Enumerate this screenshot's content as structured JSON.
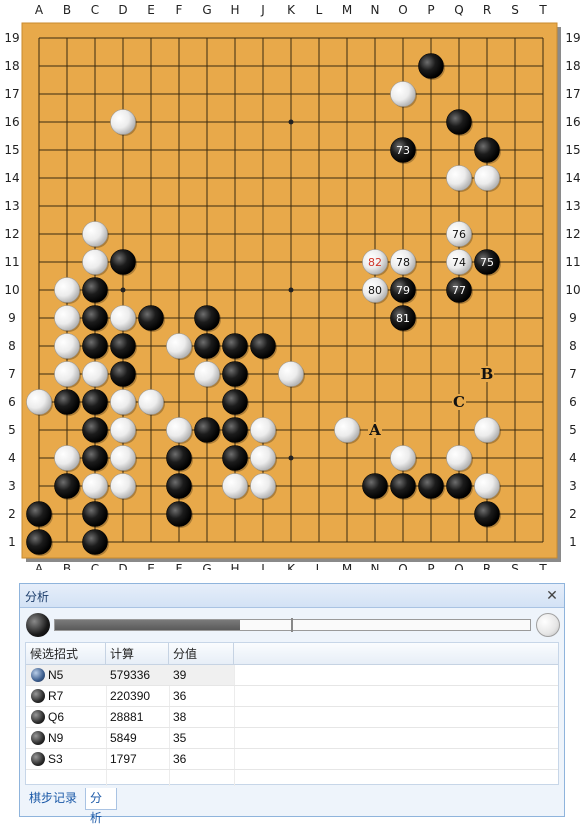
{
  "board": {
    "size": 19,
    "columns": [
      "A",
      "B",
      "C",
      "D",
      "E",
      "F",
      "G",
      "H",
      "J",
      "K",
      "L",
      "M",
      "N",
      "O",
      "P",
      "Q",
      "R",
      "S",
      "T"
    ],
    "rows": [
      "19",
      "18",
      "17",
      "16",
      "15",
      "14",
      "13",
      "12",
      "11",
      "10",
      "9",
      "8",
      "7",
      "6",
      "5",
      "4",
      "3",
      "2",
      "1"
    ],
    "colors": {
      "wood": "#e8a94a",
      "line": "#3a2a10",
      "shadow": "#8a8a8a"
    },
    "black_stones": [
      "P18",
      "Q16",
      "R15",
      "D11",
      "C10",
      "C9",
      "E9",
      "G9",
      "C8",
      "D8",
      "G8",
      "H8",
      "J8",
      "D7",
      "H7",
      "B6",
      "C6",
      "H6",
      "C5",
      "G5",
      "H5",
      "C4",
      "F4",
      "H4",
      "B3",
      "F3",
      "N3",
      "O3",
      "P3",
      "Q3",
      "A2",
      "C2",
      "F2",
      "R2",
      "A1",
      "C1"
    ],
    "white_stones": [
      "O17",
      "D16",
      "Q14",
      "R14",
      "C12",
      "C11",
      "B10",
      "B9",
      "D9",
      "B8",
      "F8",
      "H8x",
      "B7",
      "C7",
      "G7",
      "K7",
      "A6",
      "D6",
      "E6",
      "C8w",
      "D5",
      "F5",
      "J5",
      "M5",
      "R5",
      "B4",
      "D4",
      "J4",
      "O4",
      "Q4",
      "C3",
      "D3",
      "H3",
      "J3",
      "R3"
    ],
    "numbered_stones": [
      {
        "label": "73",
        "point": "O15",
        "color": "black"
      },
      {
        "label": "74",
        "point": "Q11",
        "color": "white"
      },
      {
        "label": "75",
        "point": "R11",
        "color": "black"
      },
      {
        "label": "76",
        "point": "Q12",
        "color": "white"
      },
      {
        "label": "77",
        "point": "Q10",
        "color": "black"
      },
      {
        "label": "78",
        "point": "O11",
        "color": "white"
      },
      {
        "label": "79",
        "point": "O10",
        "color": "black"
      },
      {
        "label": "80",
        "point": "N10",
        "color": "white"
      },
      {
        "label": "81",
        "point": "O9",
        "color": "black"
      },
      {
        "label": "82",
        "point": "N11",
        "color": "white",
        "text_color": "#d0352a"
      }
    ],
    "markers": [
      {
        "label": "A",
        "point": "N5"
      },
      {
        "label": "B",
        "point": "R7"
      },
      {
        "label": "C",
        "point": "Q6"
      }
    ],
    "star_points": [
      "D16",
      "K16",
      "Q16",
      "D10",
      "K10",
      "Q10",
      "D4",
      "K4",
      "Q4"
    ]
  },
  "panel": {
    "title": "分析",
    "close_icon": "✕",
    "winrate_black_fraction": 0.39,
    "table": {
      "headers": [
        "候选招式",
        "计算",
        "分值"
      ],
      "rows": [
        {
          "move": "N5",
          "visits": "579336",
          "score": "39",
          "selected": true,
          "stone": "blue"
        },
        {
          "move": "R7",
          "visits": "220390",
          "score": "36",
          "selected": false,
          "stone": "black"
        },
        {
          "move": "Q6",
          "visits": "28881",
          "score": "38",
          "selected": false,
          "stone": "black"
        },
        {
          "move": "N9",
          "visits": "5849",
          "score": "35",
          "selected": false,
          "stone": "black"
        },
        {
          "move": "S3",
          "visits": "1797",
          "score": "36",
          "selected": false,
          "stone": "black"
        }
      ]
    },
    "tabs": {
      "moves": "棋步记录",
      "analysis": "分析"
    }
  }
}
